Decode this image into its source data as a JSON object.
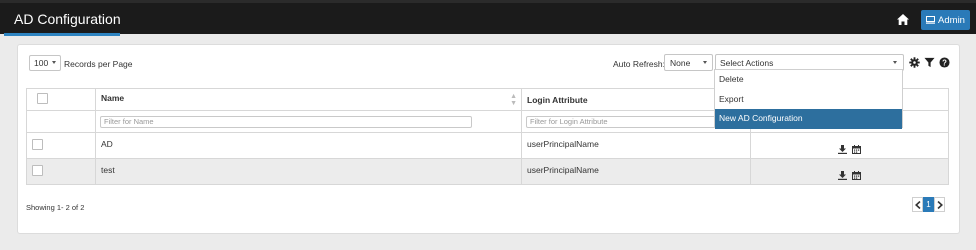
{
  "header": {
    "title": "AD Configuration",
    "admin_label": "Admin",
    "home_icon": "home-icon",
    "admin_icon": "monitor-icon"
  },
  "toolbar": {
    "records_per_page_value": "100",
    "records_per_page_label": "Records per Page",
    "auto_refresh_label": "Auto Refresh:",
    "auto_refresh_value": "None",
    "actions_placeholder": "Select Actions",
    "icons": [
      "gear-icon",
      "filter-icon",
      "help-icon"
    ]
  },
  "actions_menu": {
    "items": [
      {
        "label": "Delete"
      },
      {
        "label": "Export"
      },
      {
        "label": "New AD Configuration"
      }
    ],
    "selected_index": 2
  },
  "table": {
    "columns": [
      "Name",
      "Login Attribute"
    ],
    "filters": {
      "name_placeholder": "Filter for Name",
      "login_placeholder": "Filter for Login Attribute"
    },
    "rows": [
      {
        "name": "AD",
        "login_attribute": "userPrincipalName"
      },
      {
        "name": "test",
        "login_attribute": "userPrincipalName"
      }
    ],
    "row_icons": [
      "download-icon",
      "calendar-icon"
    ]
  },
  "footer": {
    "showing": "Showing 1- 2 of 2",
    "current_page": "1"
  },
  "colors": {
    "topbar": "#1b1b1b",
    "accent": "#2a7ab8",
    "selected": "#2d6f9e"
  }
}
